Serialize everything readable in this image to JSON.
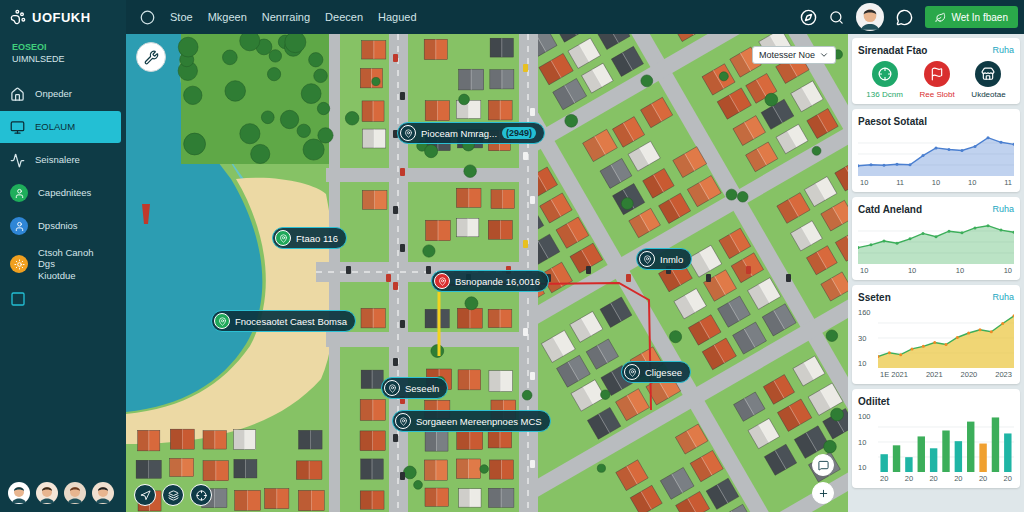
{
  "app": {
    "logo": "UOFUKH",
    "subtitle": "EOSEOI",
    "subtitle2": "UIMNLSEDE"
  },
  "topnav": [
    "Stoe",
    "Mkgeen",
    "Nenrraing",
    "Deecen",
    "Hagued"
  ],
  "action_button": "Wet In fbaen",
  "sidebar": {
    "items": [
      {
        "label": "Onpeder",
        "selected": false,
        "kind": "plain"
      },
      {
        "label": "EOLAUM",
        "selected": true,
        "kind": "plain"
      },
      {
        "label": "Seisnalere",
        "selected": false,
        "kind": "plain"
      },
      {
        "label": "Capednitees",
        "selected": false,
        "kind": "badge",
        "color": "#1fae5b"
      },
      {
        "label": "Dpsdnios",
        "selected": false,
        "kind": "badge",
        "color": "#2f86d6"
      },
      {
        "label": "Ctsoh Canoh Dgs",
        "sublabel": "Kiuotdue",
        "selected": false,
        "kind": "badge",
        "color": "#f0a020"
      }
    ]
  },
  "map": {
    "dropdown": "Motesser Noe",
    "pins": [
      {
        "label": "Pioceam Nmrag...",
        "badge": "(2949)",
        "color": "#0f3a44"
      },
      {
        "label": "Ftaao 116",
        "color": "#1fa85a"
      },
      {
        "label": "Bsnopande 16,0016",
        "color": "#d92e2e"
      },
      {
        "label": "Fnocesaotet Caest Bomsa",
        "color": "#1fa85a"
      },
      {
        "label": "Seseeln",
        "color": "#0f3a44"
      },
      {
        "label": "Sorgaeen Mereenpnoes MCS",
        "color": "#0f3a44"
      },
      {
        "label": "Cligesee",
        "color": "#0f3a44"
      },
      {
        "label": "Inmlo",
        "color": "#0f3a44"
      }
    ]
  },
  "panel": {
    "summary": {
      "title": "Sirenadat Ftao",
      "link": "Ruha",
      "actions": [
        {
          "label": "136 Dcnm",
          "color": "#1fa86a"
        },
        {
          "label": "Ree Slobt",
          "color": "#d92e2e"
        },
        {
          "label": "Ukdeotae",
          "color": "#0f3a44"
        }
      ]
    },
    "charts": [
      {
        "title": "Paesot Sotatal",
        "kind": "area",
        "color": "#4a7fd0",
        "values": [
          20,
          22,
          21,
          23,
          22,
          40,
          55,
          52,
          50,
          58,
          75,
          66,
          62
        ],
        "x_ticks": [
          "10",
          "11",
          "10",
          "10",
          "11"
        ],
        "y_ticks": []
      },
      {
        "title": "Catd Aneland",
        "link": "Ruha",
        "kind": "area",
        "color": "#3cae5a",
        "values": [
          30,
          35,
          42,
          38,
          46,
          56,
          50,
          60,
          57,
          66,
          70,
          62,
          58
        ],
        "x_ticks": [
          "10",
          "10",
          "10",
          "10"
        ],
        "y_ticks": []
      },
      {
        "title": "Sseten",
        "link": "Ruha",
        "kind": "line",
        "color": "#e9c43a",
        "values": [
          18,
          24,
          21,
          30,
          34,
          40,
          37,
          48,
          55,
          60,
          57,
          70,
          82
        ],
        "x_ticks": [
          "1E 2021",
          "2021",
          "2020",
          "2023"
        ],
        "y_ticks": [
          "160",
          "30",
          "10"
        ]
      },
      {
        "title": "Odiitet",
        "kind": "bar",
        "color": "#1fb5a5",
        "bars": [
          {
            "value": 30,
            "color": "#1fb5a5"
          },
          {
            "value": 45,
            "color": "#3cae5a"
          },
          {
            "value": 25,
            "color": "#1fb5a5"
          },
          {
            "value": 60,
            "color": "#3cae5a"
          },
          {
            "value": 40,
            "color": "#1fb5a5"
          },
          {
            "value": 70,
            "color": "#3cae5a"
          },
          {
            "value": 52,
            "color": "#1fb5a5"
          },
          {
            "value": 85,
            "color": "#3cae5a"
          },
          {
            "value": 48,
            "color": "#f0a030"
          },
          {
            "value": 92,
            "color": "#3cae5a"
          },
          {
            "value": 65,
            "color": "#1fb5a5"
          }
        ],
        "x_ticks": [
          "20",
          "20",
          "20",
          "20",
          "20",
          "20"
        ],
        "y_ticks": [
          "100",
          "10",
          "10"
        ]
      }
    ]
  }
}
